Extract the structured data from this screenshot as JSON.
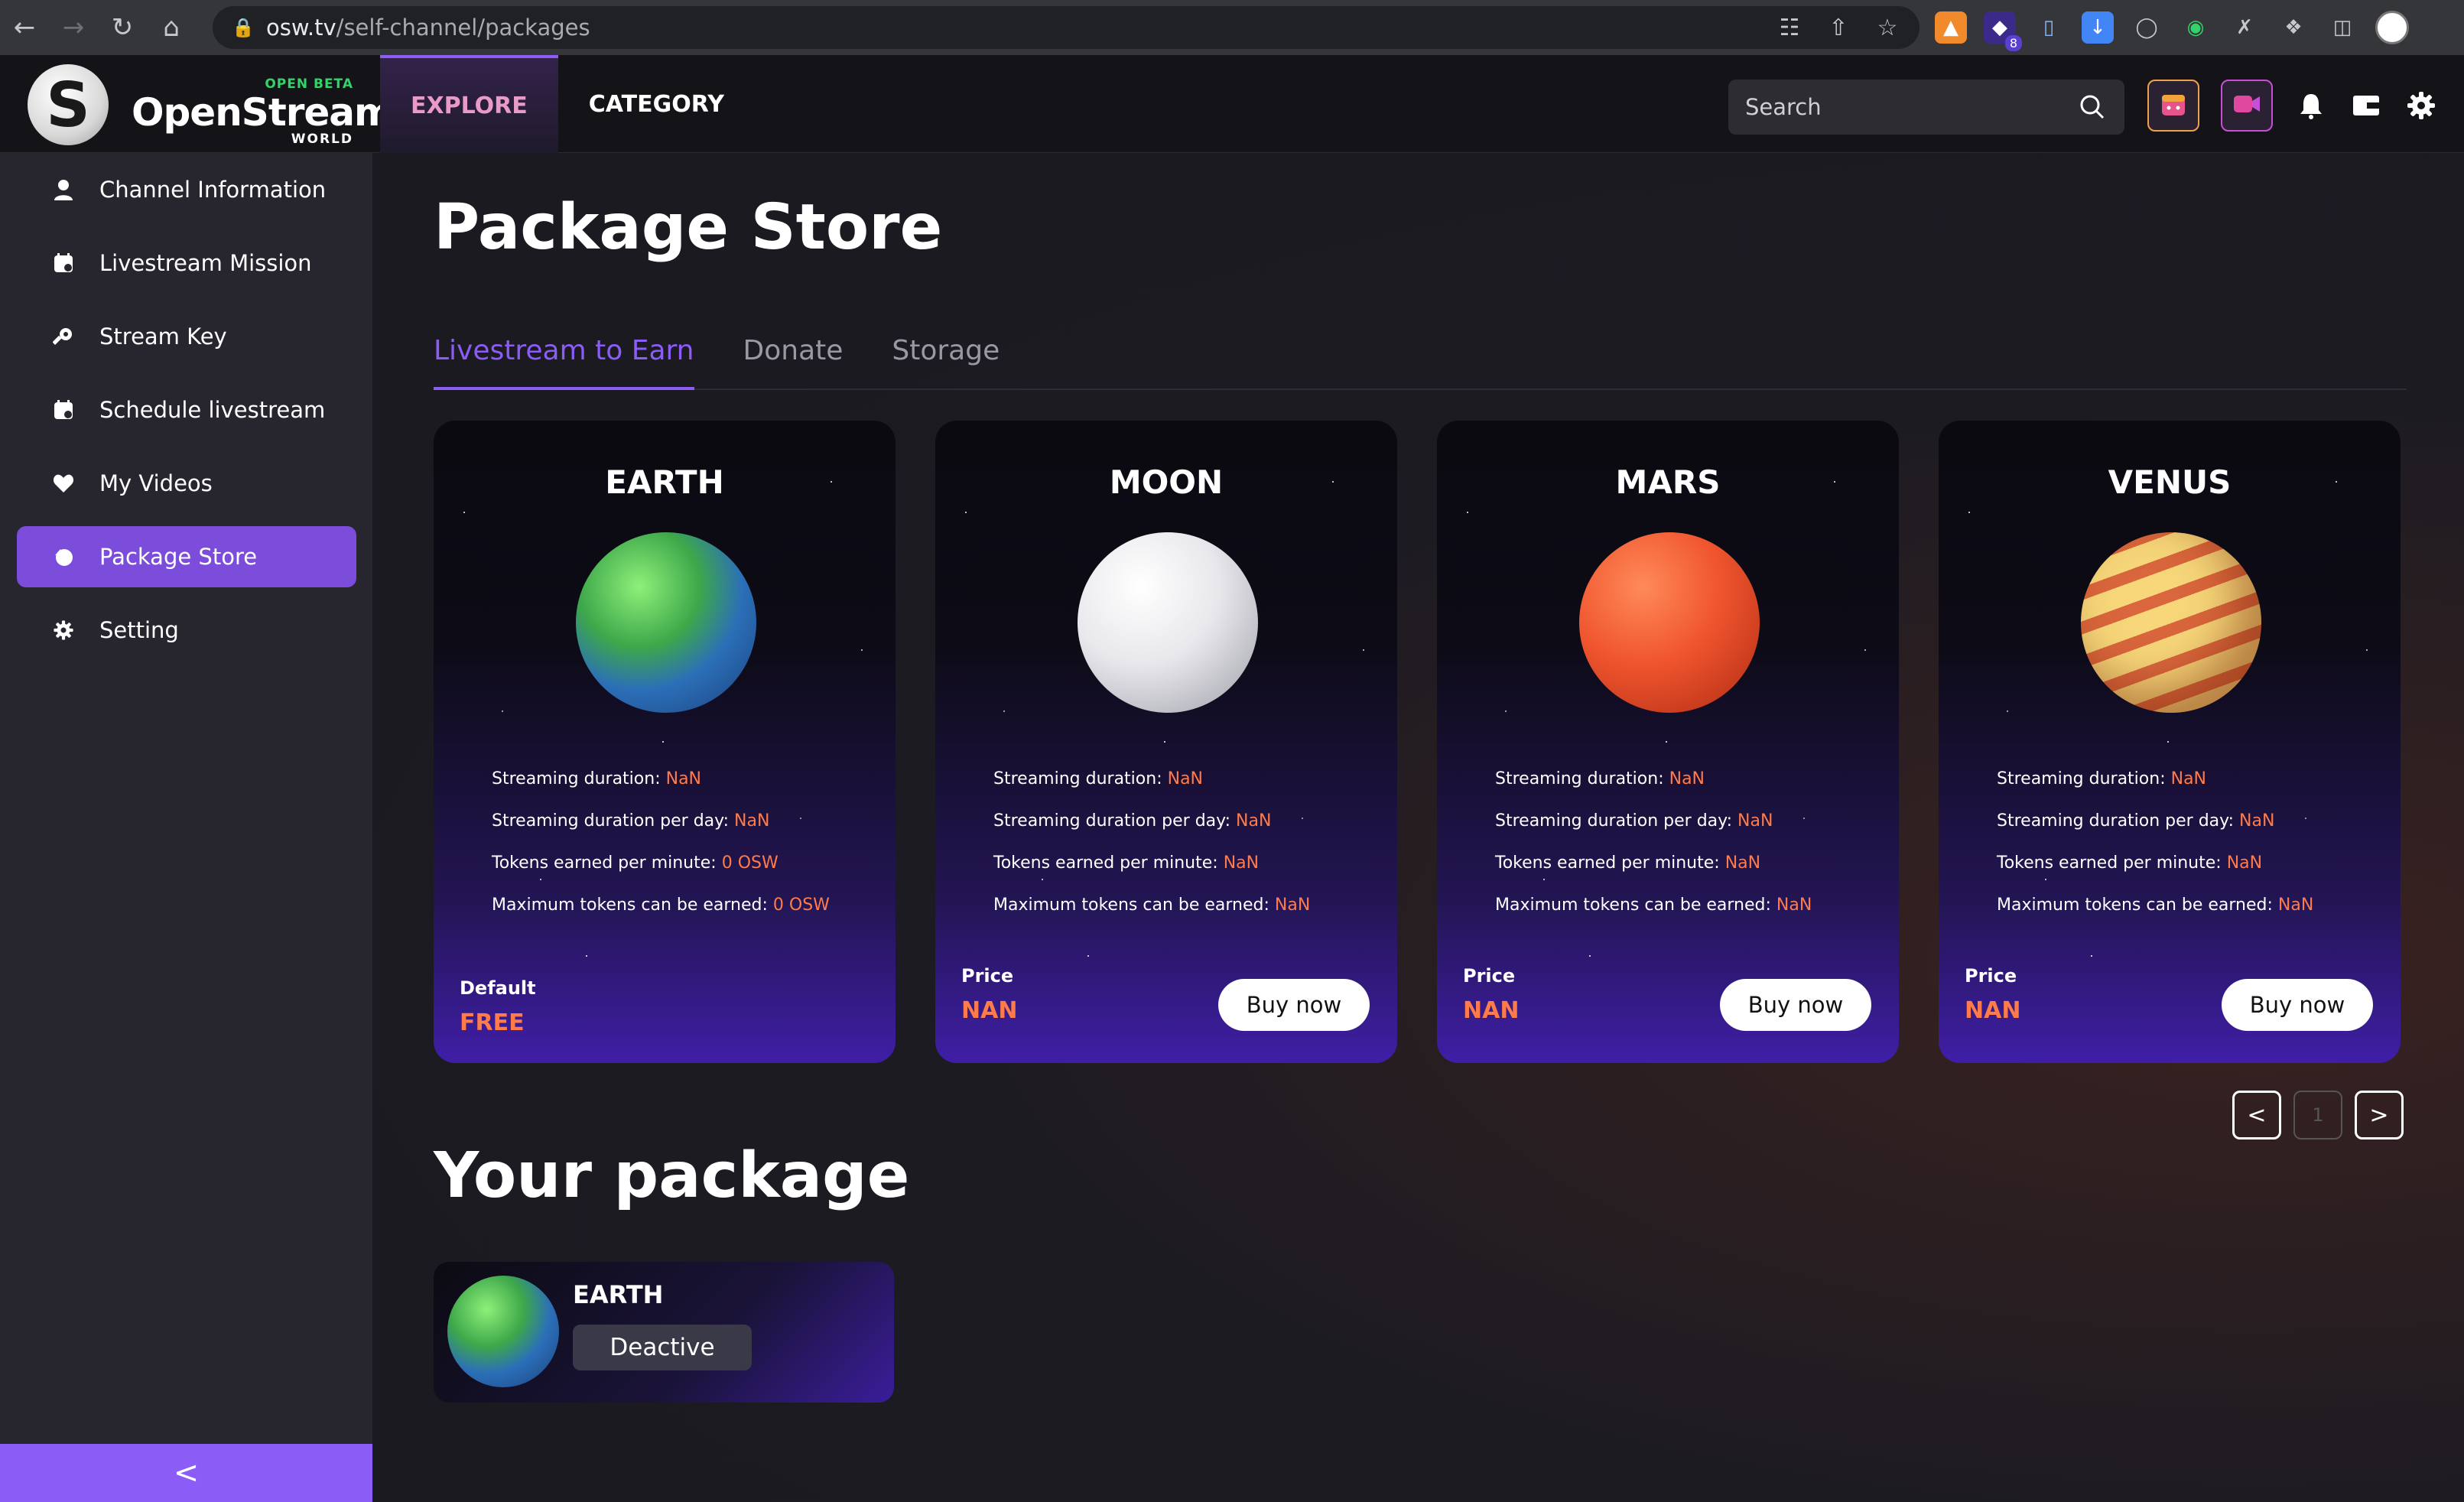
{
  "browser": {
    "url_host": "osw.tv",
    "url_path": "/self-channel/packages",
    "extension_badge": "8"
  },
  "header": {
    "logo_beta": "OPEN BETA",
    "logo_name": "OpenStream",
    "logo_world": "WORLD",
    "nav": [
      {
        "label": "EXPLORE",
        "active": true
      },
      {
        "label": "CATEGORY",
        "active": false
      }
    ],
    "search_placeholder": "Search"
  },
  "sidebar": {
    "items": [
      {
        "label": "Channel Information",
        "icon": "user-icon"
      },
      {
        "label": "Livestream Mission",
        "icon": "calendar-icon"
      },
      {
        "label": "Stream Key",
        "icon": "key-icon"
      },
      {
        "label": "Schedule livestream",
        "icon": "calendar-icon"
      },
      {
        "label": "My Videos",
        "icon": "heart-icon"
      },
      {
        "label": "Package Store",
        "icon": "package-icon",
        "active": true
      },
      {
        "label": "Setting",
        "icon": "gear-icon"
      }
    ],
    "collapse_label": "<"
  },
  "main": {
    "title": "Package Store",
    "tabs": [
      {
        "label": "Livestream to Earn",
        "active": true
      },
      {
        "label": "Donate",
        "active": false
      },
      {
        "label": "Storage",
        "active": false
      }
    ],
    "stat_labels": {
      "duration": "Streaming duration:",
      "per_day": "Streaming duration per day:",
      "per_minute": "Tokens earned per minute:",
      "max": "Maximum tokens can be earned:"
    },
    "cards": [
      {
        "name": "EARTH",
        "duration": "NaN",
        "per_day": "NaN",
        "per_minute": "0 OSW",
        "max": "0 OSW",
        "footer_label": "Default",
        "footer_value": "FREE",
        "button": ""
      },
      {
        "name": "MOON",
        "duration": "NaN",
        "per_day": "NaN",
        "per_minute": "NaN",
        "max": "NaN",
        "footer_label": "Price",
        "footer_value": "NAN",
        "button": "Buy now"
      },
      {
        "name": "MARS",
        "duration": "NaN",
        "per_day": "NaN",
        "per_minute": "NaN",
        "max": "NaN",
        "footer_label": "Price",
        "footer_value": "NAN",
        "button": "Buy now"
      },
      {
        "name": "VENUS",
        "duration": "NaN",
        "per_day": "NaN",
        "per_minute": "NaN",
        "max": "NaN",
        "footer_label": "Price",
        "footer_value": "NAN",
        "button": "Buy now"
      }
    ],
    "pager": {
      "prev": "<",
      "page": "1",
      "next": ">"
    },
    "your_package": {
      "title": "Your package",
      "name": "EARTH",
      "status": "Deactive"
    }
  },
  "colors": {
    "accent": "#8b5cf6",
    "value_orange": "#ff7b4a",
    "explore_pink": "#e89bc9",
    "beta_green": "#34d26b"
  }
}
